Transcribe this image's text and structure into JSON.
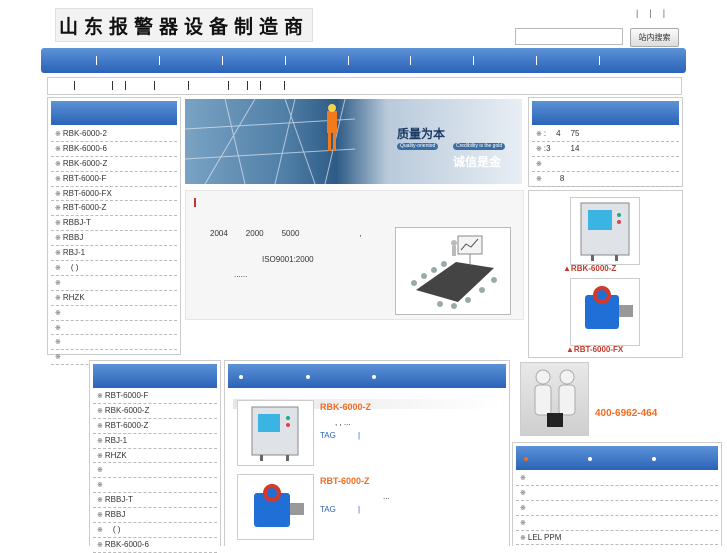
{
  "header": {
    "logo_text": "山东报警器设备制造商",
    "top_links": [
      "|",
      "|",
      "|"
    ],
    "search_placeholder": "",
    "search_button": "站内搜索"
  },
  "nav": {
    "separators": 9
  },
  "left_panel": {
    "items": [
      "RBK-6000-2",
      "RBK-6000-6",
      "RBK-6000-Z",
      "RBT-6000-F",
      "RBT-6000-FX",
      "RBT-6000-Z",
      "RBBJ-T",
      "RBBJ",
      "RBJ-1",
      "(  )",
      "",
      "RHZK",
      "",
      "",
      "",
      ""
    ]
  },
  "banner": {
    "headline1": "质量为本",
    "headline2": "诚信是金",
    "pill1": "Quality-oriented",
    "pill2": "Credibility is the gold"
  },
  "about": {
    "line1_a": "2004",
    "line1_b": "2000",
    "line1_c": "5000",
    "line1_d": ",",
    "line2": "ISO9001:2000",
    "line3": "......"
  },
  "right_panel": {
    "items": [
      {
        "a": ":",
        "b": "4",
        "c": "75"
      },
      {
        "a": ":3",
        "b": "",
        "c": "14"
      },
      {
        "a": "",
        "b": "",
        "c": ""
      },
      {
        "a": "",
        "b": "8",
        "c": ""
      }
    ],
    "products": [
      {
        "label": "▲RBK-6000-Z"
      },
      {
        "label": "▲RBT-6000-FX"
      }
    ]
  },
  "left_panel_2": {
    "items": [
      "RBT-6000-F",
      "RBK-6000-Z",
      "RBT-6000-Z",
      "RBJ-1",
      "RHZK",
      "",
      "",
      "RBBJ-T",
      "RBBJ",
      "(  )",
      "RBK-6000-6"
    ]
  },
  "products_center": [
    {
      "name": "RBK-6000-Z",
      "desc": ",          ,  ...",
      "tag": "TAG",
      "sep": "|"
    },
    {
      "name": "RBT-6000-Z",
      "desc": "...",
      "tag": "TAG",
      "sep": "|"
    }
  ],
  "contact": {
    "phone": "400-6962-464"
  },
  "news_panel": {
    "items": [
      "",
      "",
      "",
      "",
      "LEL PPM"
    ]
  }
}
